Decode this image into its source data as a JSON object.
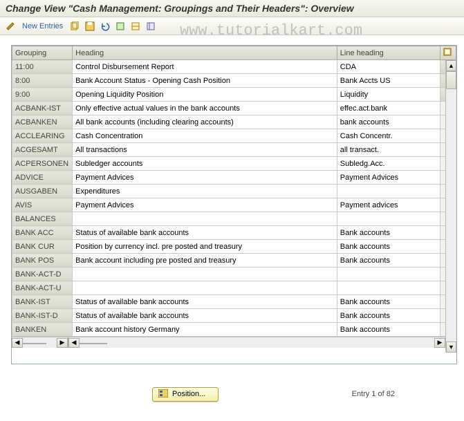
{
  "title": "Change View \"Cash Management: Groupings and Their Headers\": Overview",
  "toolbar": {
    "new_entries": "New Entries"
  },
  "watermark": "www.tutorialkart.com",
  "table": {
    "headers": {
      "grouping": "Grouping",
      "heading": "Heading",
      "line_heading": "Line heading"
    },
    "rows": [
      {
        "grouping": "11:00",
        "heading": "Control Disbursement Report",
        "line": "CDA"
      },
      {
        "grouping": "8:00",
        "heading": "Bank Account Status - Opening Cash Position",
        "line": "Bank Accts US"
      },
      {
        "grouping": "9:00",
        "heading": " Opening Liquidity Position",
        "line": "Liquidity"
      },
      {
        "grouping": "ACBANK-IST",
        "heading": "Only effective actual values in the bank accounts",
        "line": "effec.act.bank"
      },
      {
        "grouping": "ACBANKEN",
        "heading": "All bank accounts (including clearing accounts)",
        "line": "bank accounts"
      },
      {
        "grouping": "ACCLEARING",
        "heading": "Cash Concentration",
        "line": "Cash Concentr."
      },
      {
        "grouping": "ACGESAMT",
        "heading": "All transactions",
        "line": "all transact."
      },
      {
        "grouping": "ACPERSONEN",
        "heading": "Subledger accounts",
        "line": "Subledg.Acc."
      },
      {
        "grouping": "ADVICE",
        "heading": "Payment Advices",
        "line": "Payment Advices"
      },
      {
        "grouping": "AUSGABEN",
        "heading": "Expenditures",
        "line": ""
      },
      {
        "grouping": "AVIS",
        "heading": "Payment Advices",
        "line": "Payment advices"
      },
      {
        "grouping": "BALANCES",
        "heading": "",
        "line": ""
      },
      {
        "grouping": "BANK ACC",
        "heading": "Status of available bank accounts",
        "line": "Bank accounts"
      },
      {
        "grouping": "BANK CUR",
        "heading": "Position by currency incl. pre posted and treasury",
        "line": "Bank accounts"
      },
      {
        "grouping": "BANK POS",
        "heading": "Bank account including pre posted and treasury",
        "line": "Bank accounts"
      },
      {
        "grouping": "BANK-ACT-D",
        "heading": "",
        "line": ""
      },
      {
        "grouping": "BANK-ACT-U",
        "heading": "",
        "line": ""
      },
      {
        "grouping": "BANK-IST",
        "heading": "Status of available bank accounts",
        "line": "Bank accounts"
      },
      {
        "grouping": "BANK-IST-D",
        "heading": "Status of available bank accounts",
        "line": "Bank accounts"
      },
      {
        "grouping": "BANKEN",
        "heading": "Bank account history Germany",
        "line": "Bank accounts"
      }
    ]
  },
  "footer": {
    "position_label": "Position...",
    "entry_text": "Entry 1 of 82"
  }
}
